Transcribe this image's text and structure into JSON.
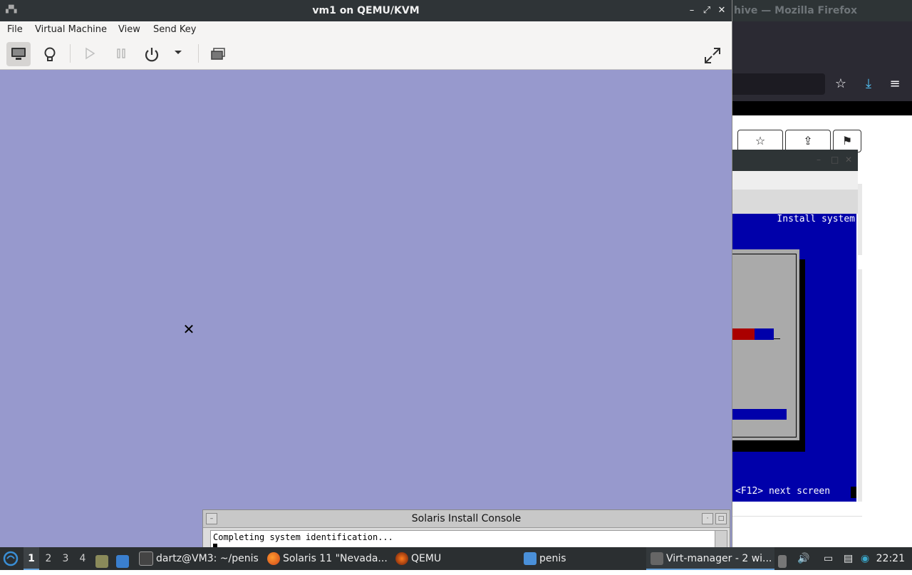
{
  "firefox": {
    "title_fragment": "hive — Mozilla Firefox"
  },
  "vm_screen": {
    "header": "Install system",
    "footer": "<F12> next screen"
  },
  "window": {
    "title": "vm1 on QEMU/KVM",
    "menu": [
      "File",
      "Virtual Machine",
      "View",
      "Send Key"
    ]
  },
  "solaris_console": {
    "title": "Solaris Install Console",
    "line": "Completing system identification..."
  },
  "taskbar": {
    "workspaces": [
      "1",
      "2",
      "3",
      "4"
    ],
    "tasks": [
      {
        "label": "dartz@VM3: ~/penis"
      },
      {
        "label": "Solaris 11 \"Nevada..."
      },
      {
        "label": "QEMU"
      },
      {
        "label": "penis"
      },
      {
        "label": "Virt-manager - 2 wi..."
      }
    ],
    "clock": "22:21"
  },
  "colors": {
    "vm_background": "#9799cd",
    "installer_blue": "#0000aa",
    "titlebar": "#2f3437",
    "taskbar": "#2b2f31"
  }
}
